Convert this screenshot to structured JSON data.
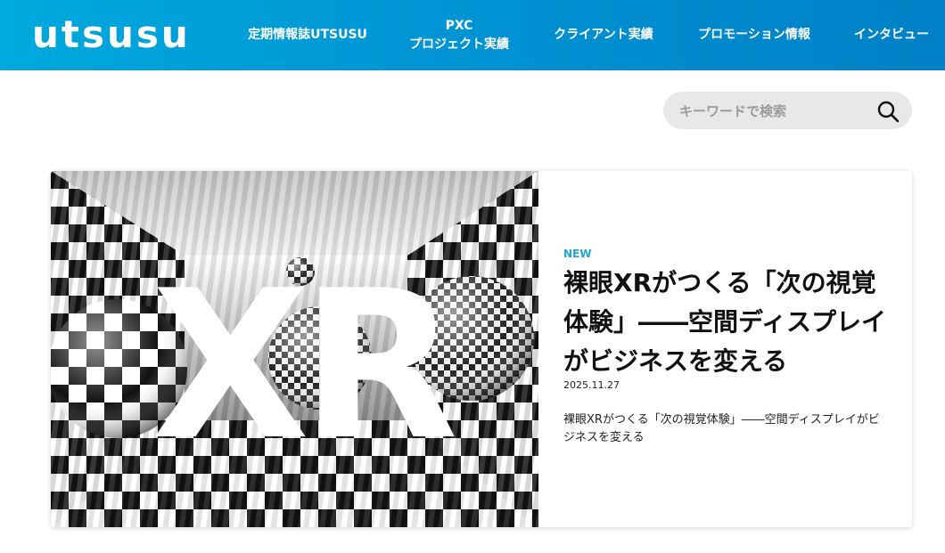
{
  "brand": {
    "logo_text": "utsusu",
    "header_color_start": "#00a9de",
    "header_color_end": "#0080c6"
  },
  "nav": {
    "item_1": "定期情報誌UTSUSU",
    "item_2_line1": "PXC",
    "item_2_line2": "プロジェクト実績",
    "item_3": "クライアント実績",
    "item_4": "プロモーション情報",
    "item_5": "インタビュー"
  },
  "search": {
    "placeholder": "キーワードで検索",
    "icon": "search-icon"
  },
  "featured": {
    "image_text": "XR",
    "badge": "NEW",
    "badge_color": "#1fa5d6",
    "title": "裸眼XRがつくる「次の視覚体験」――空間ディスプレイがビジネスを変える",
    "date": "2025.11.27",
    "excerpt": "裸眼XRがつくる「次の視覚体験」――空間ディスプレイがビジネスを変える"
  }
}
